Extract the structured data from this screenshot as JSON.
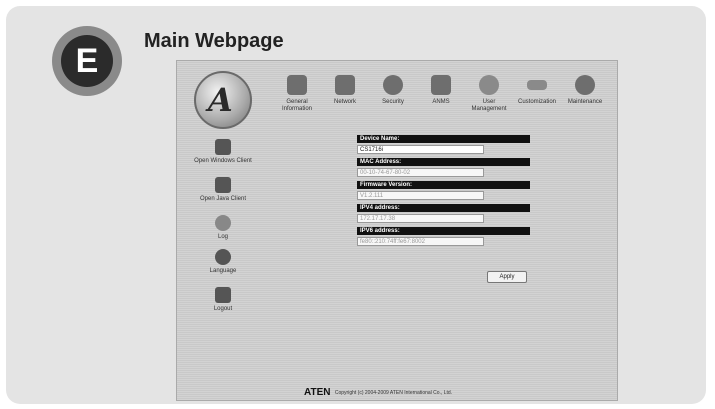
{
  "badge": {
    "letter": "E"
  },
  "heading": "Main Webpage",
  "nav": [
    {
      "line1": "General",
      "line2": "Information",
      "icon": "general-information-icon"
    },
    {
      "line1": "Network",
      "line2": "",
      "icon": "network-icon"
    },
    {
      "line1": "Security",
      "line2": "",
      "icon": "security-icon"
    },
    {
      "line1": "ANMS",
      "line2": "",
      "icon": "anms-icon"
    },
    {
      "line1": "User",
      "line2": "Management",
      "icon": "user-management-icon"
    },
    {
      "line1": "Customization",
      "line2": "",
      "icon": "customization-icon"
    },
    {
      "line1": "Maintenance",
      "line2": "",
      "icon": "maintenance-icon"
    }
  ],
  "sidebar": [
    {
      "label": "Open Windows Client",
      "icon": "windows-client-icon"
    },
    {
      "label": "Open Java Client",
      "icon": "java-client-icon"
    },
    {
      "label": "Log",
      "icon": "log-icon"
    },
    {
      "label": "Language",
      "icon": "language-icon"
    },
    {
      "label": "Logout",
      "icon": "logout-icon"
    }
  ],
  "form": {
    "device_name_label": "Device Name:",
    "device_name_value": "CS1716i",
    "mac_label": "MAC Address:",
    "mac_value": "00-10-74-67-80-02",
    "firmware_label": "Firmware Version:",
    "firmware_value": "V1.2.111",
    "ipv4_label": "IPV4 address:",
    "ipv4_value": "172.17.17.38",
    "ipv6_label": "IPV6 address:",
    "ipv6_value": "fe80::210:74ff:fe67:8002",
    "apply_label": "Apply"
  },
  "footer": {
    "brand": "ATEN",
    "copyright": "Copyright (c) 2004-2009 ATEN International Co., Ltd."
  }
}
